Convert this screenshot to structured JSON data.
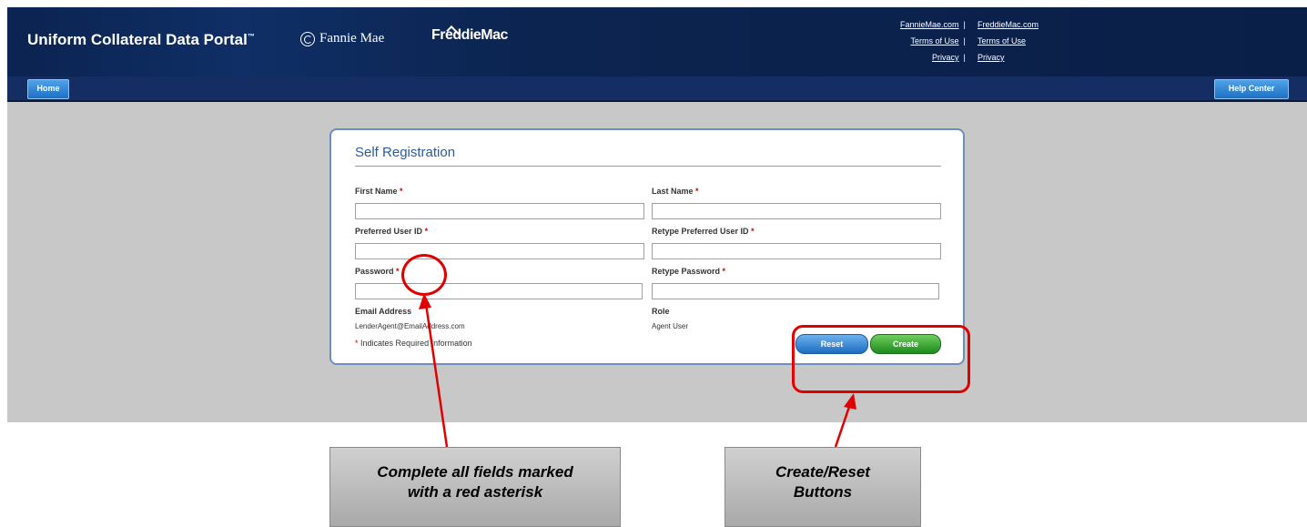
{
  "header": {
    "app_title": "Uniform Collateral Data Portal",
    "app_title_tm": "™",
    "fannie_logo": "Fannie Mae",
    "freddie_logo": "FreddieMac",
    "links": {
      "fannie_site": "FannieMae.com",
      "freddie_site": "FreddieMac.com",
      "terms_fannie": "Terms of Use",
      "terms_freddie": "Terms of Use",
      "privacy_fannie": "Privacy",
      "privacy_freddie": "Privacy",
      "separator": "|"
    }
  },
  "nav": {
    "home": "Home",
    "help_center": "Help Center"
  },
  "form": {
    "title": "Self Registration",
    "first_name_label": "First Name",
    "last_name_label": "Last Name",
    "user_id_label": "Preferred User ID",
    "retype_user_id_label": "Retype Preferred User ID",
    "password_label": "Password",
    "retype_password_label": "Retype Password",
    "email_label": "Email Address",
    "email_value": "LenderAgent@EmailAddress.com",
    "role_label": "Role",
    "role_value": "Agent User",
    "required_marker": "*",
    "required_note": "Indicates Required Information",
    "reset_button": "Reset",
    "create_button": "Create",
    "fields": {
      "first_name": "",
      "last_name": "",
      "user_id": "",
      "retype_user_id": "",
      "password": "",
      "retype_password": ""
    }
  },
  "annotations": {
    "required_callout_line1": "Complete all fields marked",
    "required_callout_line2": "with a red asterisk",
    "buttons_callout_line1": "Create/Reset",
    "buttons_callout_line2": "Buttons",
    "highlight_color": "#e00000"
  }
}
